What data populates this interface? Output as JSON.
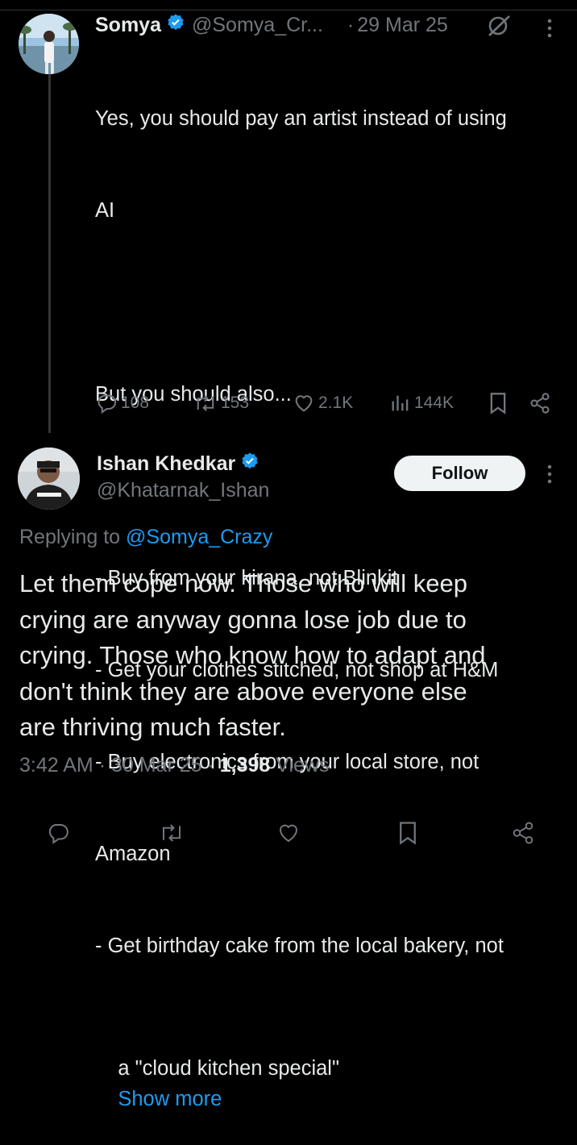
{
  "parent_tweet": {
    "display_name": "Somya",
    "handle": "@Somya_Cr...",
    "separator": "·",
    "date": "29 Mar 25",
    "text_lines": [
      "Yes, you should pay an artist instead of using",
      "AI",
      "",
      "But you should also...",
      "",
      "- Buy from your kirana, not Blinkit",
      "- Get your clothes stitched, not shop at H&M",
      "- Buy electronics from your local store, not",
      "Amazon",
      "- Get birthday cake from the local bakery, not"
    ],
    "last_line": "a \"cloud kitchen special\"",
    "show_more": "Show more",
    "replies": "108",
    "reposts": "153",
    "likes": "2.1K",
    "views": "144K"
  },
  "main_tweet": {
    "display_name": "Ishan Khedkar",
    "handle": "@Khatarnak_Ishan",
    "follow_label": "Follow",
    "replying_prefix": "Replying to",
    "replying_to": "@Somya_Crazy",
    "text_lines": [
      "Let them cope now. Those who will keep",
      "crying are anyway gonna lose job due to",
      "crying. Those who know how to adapt and",
      "don't think they are above everyone else",
      "are thriving much faster."
    ],
    "time": "3:42 AM",
    "sep1": "·",
    "date": "30 Mar 25",
    "sep2": "·",
    "views_count": "1,398",
    "views_label": "Views"
  },
  "colors": {
    "background": "#000000",
    "text": "#e7e9ea",
    "muted": "#71767b",
    "link": "#1d9bf0",
    "verified": "#1d9bf0"
  },
  "icons": [
    "verified-badge-icon",
    "grok-icon",
    "more-icon",
    "reply-icon",
    "repost-icon",
    "like-icon",
    "views-icon",
    "bookmark-icon",
    "share-icon"
  ]
}
